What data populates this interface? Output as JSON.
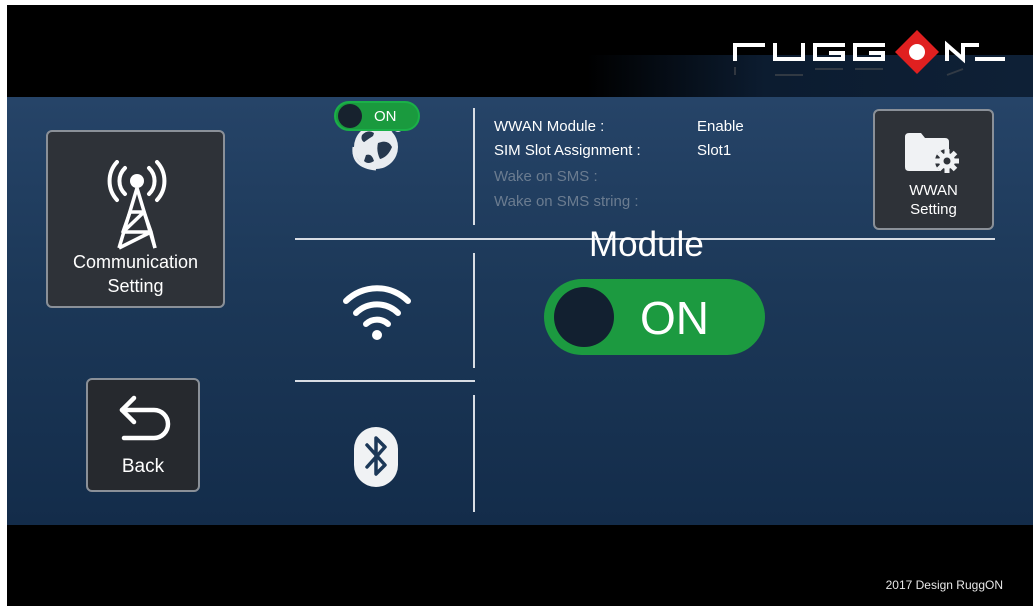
{
  "brand": {
    "logo_text": "RUGGON"
  },
  "sidebar": {
    "communication": {
      "label_line1": "Communication",
      "label_line2": "Setting"
    },
    "back": {
      "label": "Back"
    }
  },
  "wwan": {
    "toggle_label": "ON",
    "toggle_state": "on",
    "info": {
      "module_label": "WWAN Module :",
      "module_value": "Enable",
      "sim_label": "SIM Slot Assignment :",
      "sim_value": "Slot1",
      "wake_sms_label": "Wake on SMS :",
      "wake_sms_string_label": "Wake on SMS string :"
    },
    "setting_button": {
      "label_line1": "WWAN",
      "label_line2": "Setting"
    }
  },
  "module_panel": {
    "title": "Module",
    "toggle_label": "ON",
    "toggle_state": "on"
  },
  "footer": {
    "copyright": "2017 Design RuggON"
  },
  "colors": {
    "toggle_on": "#1c9a40",
    "background_top": "#264468",
    "background_bottom": "#132c4a",
    "logo_red": "#e02020"
  },
  "icons": [
    "antenna-tower-icon",
    "globe-satellite-icon",
    "wifi-icon",
    "bluetooth-icon",
    "folder-gear-icon",
    "back-arrow-icon"
  ]
}
